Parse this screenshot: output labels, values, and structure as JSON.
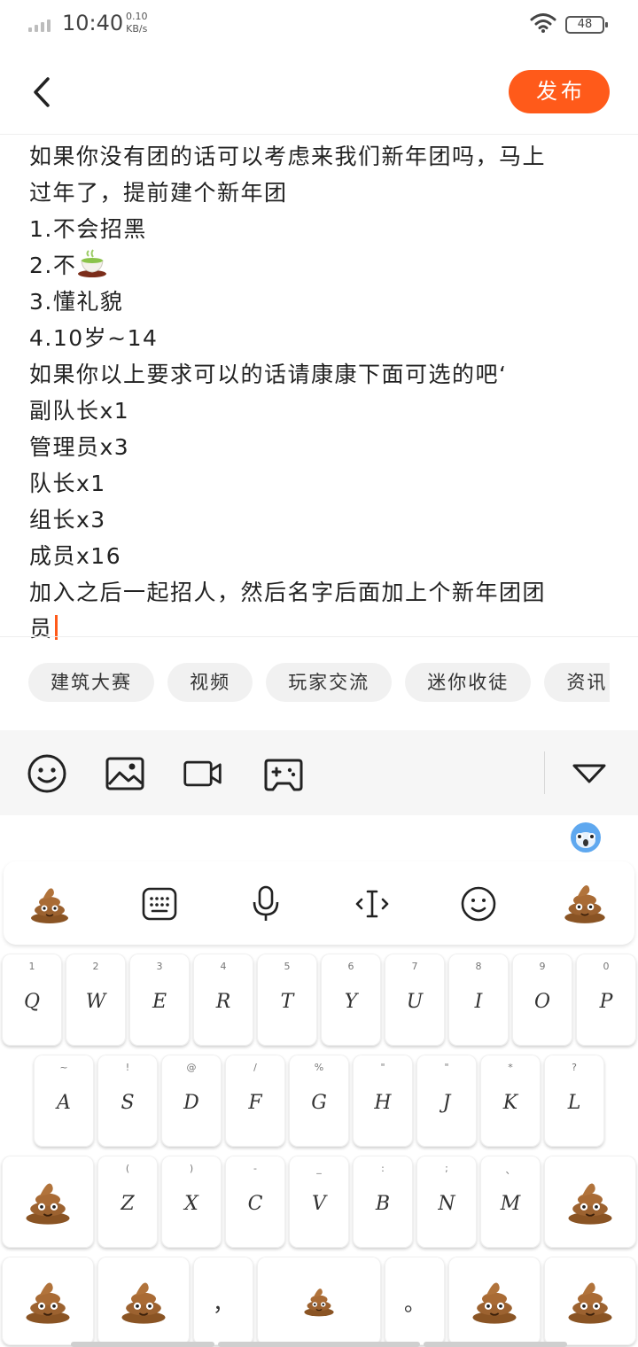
{
  "status_bar": {
    "time": "10:40",
    "speed_value": "0.10",
    "speed_unit": "KB/s",
    "battery": "48"
  },
  "header": {
    "publish_label": "发布"
  },
  "editor": {
    "lines": [
      "如果你没有团的话可以考虑来我们新年团吗，马上",
      "过年了，提前建个新年团",
      "1.不会招黑",
      "2.不",
      "3.懂礼貌",
      "4.10岁~14",
      "如果你以上要求可以的话请康康下面可选的吧‘",
      "副队长x1",
      "管理员x3",
      "队长x1",
      "组长x3",
      "成员x16",
      "加入之后一起招人，然后名字后面加上个新年团团",
      "员"
    ]
  },
  "tags": [
    "建筑大赛",
    "视频",
    "玩家交流",
    "迷你收徒",
    "资讯"
  ],
  "toolbar": {
    "icons": [
      "emoji-icon",
      "image-icon",
      "video-icon",
      "gamepad-icon",
      "collapse-icon"
    ]
  },
  "keyboard": {
    "row1": [
      {
        "num": "1",
        "ch": "Q"
      },
      {
        "num": "2",
        "ch": "W"
      },
      {
        "num": "3",
        "ch": "E"
      },
      {
        "num": "4",
        "ch": "R"
      },
      {
        "num": "5",
        "ch": "T"
      },
      {
        "num": "6",
        "ch": "Y"
      },
      {
        "num": "7",
        "ch": "U"
      },
      {
        "num": "8",
        "ch": "I"
      },
      {
        "num": "9",
        "ch": "O"
      },
      {
        "num": "0",
        "ch": "P"
      }
    ],
    "row2": [
      {
        "num": "~",
        "ch": "A"
      },
      {
        "num": "!",
        "ch": "S"
      },
      {
        "num": "@",
        "ch": "D"
      },
      {
        "num": "/",
        "ch": "F"
      },
      {
        "num": "%",
        "ch": "G"
      },
      {
        "num": "\"",
        "ch": "H"
      },
      {
        "num": "\"",
        "ch": "J"
      },
      {
        "num": "*",
        "ch": "K"
      },
      {
        "num": "?",
        "ch": "L"
      }
    ],
    "row3": [
      {
        "num": "(",
        "ch": "Z"
      },
      {
        "num": ")",
        "ch": "X"
      },
      {
        "num": "-",
        "ch": "C"
      },
      {
        "num": "_",
        "ch": "V"
      },
      {
        "num": ":",
        "ch": "B"
      },
      {
        "num": ";",
        "ch": "N"
      },
      {
        "num": "、",
        "ch": "M"
      }
    ],
    "comma": "，",
    "period": "。"
  }
}
